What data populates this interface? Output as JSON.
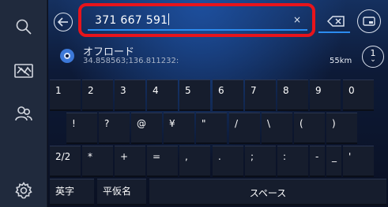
{
  "sidebar": {
    "items": [
      {
        "icon": "search-icon"
      },
      {
        "icon": "map-icon"
      },
      {
        "icon": "contacts-icon"
      },
      {
        "icon": "settings-icon"
      }
    ]
  },
  "search": {
    "value": "371 667 591",
    "clear_label": "×"
  },
  "suggestion": {
    "name": "オフロード",
    "coords": "34.858563;136.811232:",
    "distance": "55km",
    "expand_number": "1"
  },
  "keyboard": {
    "row1": [
      "1",
      "2",
      "3",
      "4",
      "5",
      "6",
      "7",
      "8",
      "9",
      "0"
    ],
    "row2": [
      "!",
      "?",
      "@",
      "¥",
      "\"",
      "/",
      "\\",
      "(",
      ")"
    ],
    "row3": [
      "2/2",
      "*",
      "+",
      "=",
      ",",
      ".",
      ";",
      ":",
      "-",
      "_",
      "'"
    ],
    "row4": {
      "alpha": "英字",
      "kana": "平仮名",
      "space": "スペース"
    }
  },
  "colors": {
    "highlight_border": "#e8141b",
    "accent": "#2c8cf0"
  }
}
